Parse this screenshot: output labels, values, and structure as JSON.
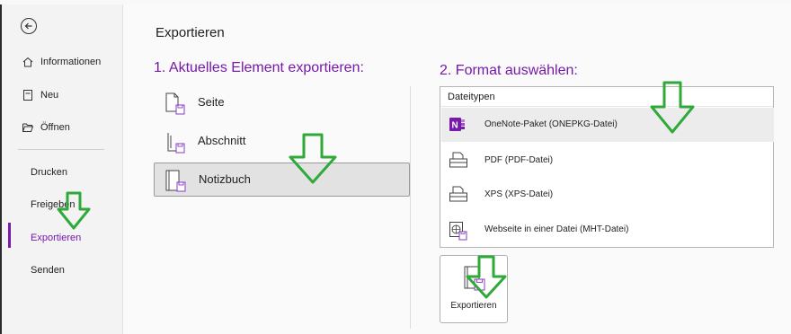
{
  "sidebar": {
    "items": [
      {
        "label": "Informationen",
        "icon": "home-icon"
      },
      {
        "label": "Neu",
        "icon": "new-page-icon"
      },
      {
        "label": "Öffnen",
        "icon": "folder-open-icon"
      },
      {
        "label": "Drucken"
      },
      {
        "label": "Freigeben"
      },
      {
        "label": "Exportieren",
        "active": true
      },
      {
        "label": "Senden"
      }
    ]
  },
  "main": {
    "title": "Exportieren",
    "step1_title": "1. Aktuelles Element exportieren:",
    "step2_title": "2. Format auswählen:",
    "elements": [
      {
        "label": "Seite"
      },
      {
        "label": "Abschnitt"
      },
      {
        "label": "Notizbuch",
        "selected": true
      }
    ],
    "file_types": {
      "header": "Dateitypen",
      "items": [
        {
          "label": "OneNote-Paket (ONEPKG-Datei)",
          "selected": true,
          "icon": "onenote-icon"
        },
        {
          "label": "PDF (PDF-Datei)",
          "icon": "printer-icon"
        },
        {
          "label": "XPS (XPS-Datei)",
          "icon": "printer-icon"
        },
        {
          "label": "Webseite in einer Datei (MHT-Datei)",
          "icon": "web-page-icon"
        }
      ]
    },
    "export_button": "Exportieren"
  },
  "colors": {
    "accent": "#7719aa",
    "annotation_arrow": "#2faa3a"
  }
}
